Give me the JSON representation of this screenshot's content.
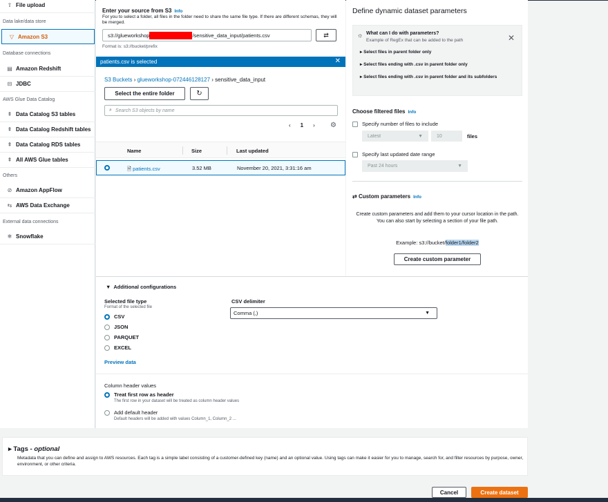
{
  "sidebar": {
    "items": [
      {
        "label": "File upload",
        "icon": "upload-icon",
        "glyph": "⇧"
      },
      {
        "label": "Amazon S3",
        "icon": "bucket-icon",
        "glyph": "▽"
      },
      {
        "label": "Amazon Redshift",
        "icon": "database-icon",
        "glyph": "▤"
      },
      {
        "label": "JDBC",
        "icon": "jdbc-icon",
        "glyph": "⊟"
      },
      {
        "label": "Data Catalog S3 tables",
        "icon": "catalog-icon",
        "glyph": "⇞"
      },
      {
        "label": "Data Catalog Redshift tables",
        "icon": "catalog-icon",
        "glyph": "⇞"
      },
      {
        "label": "Data Catalog RDS tables",
        "icon": "catalog-icon",
        "glyph": "⇞"
      },
      {
        "label": "All AWS Glue tables",
        "icon": "catalog-icon",
        "glyph": "⇞"
      },
      {
        "label": "Amazon AppFlow",
        "icon": "appflow-icon",
        "glyph": "⊘"
      },
      {
        "label": "AWS Data Exchange",
        "icon": "exchange-icon",
        "glyph": "⇆"
      },
      {
        "label": "Snowflake",
        "icon": "snowflake-icon",
        "glyph": "❄"
      }
    ],
    "sections": [
      "Data lake/data store",
      "Database connections",
      "AWS Glue Data Catalog",
      "Others",
      "External data connections"
    ]
  },
  "source": {
    "title": "Enter your source from S3",
    "info": "Info",
    "description": "For you to select a folder, all files in the folder need to share the same file type. If there are different schemas, they will be merged.",
    "path_prefix": "s3://glueworkshop",
    "path_suffix": "/sensitive_data_input/patients.csv",
    "format_hint": "Format is: s3://bucket/prefix"
  },
  "browser": {
    "banner": "patients.csv is selected",
    "crumb_root": "S3 Buckets",
    "crumb_bucket": "glueworkshop-072446128127",
    "crumb_folder": "sensitive_data_input",
    "select_folder": "Select the entire folder",
    "search_placeholder": "Search S3 objects by name",
    "page": "1",
    "columns": [
      "Name",
      "Size",
      "Last updated"
    ],
    "rows": [
      {
        "name": "patients.csv",
        "size": "3.52 MB",
        "updated": "November 20, 2021, 3:31:16 am"
      }
    ]
  },
  "params": {
    "title": "Define dynamic dataset parameters",
    "help_title": "What can I do with parameters?",
    "help_sub": "Example of RegEx that can be added to the path",
    "help_items": [
      "Select files in parent folder only",
      "Select files ending with .csv in parent folder only",
      "Select files ending with .csv in parent folder and its subfolders"
    ],
    "filtered_title": "Choose filtered files",
    "info": "Info",
    "num_files_label": "Specify number of files to include",
    "num_files_mode": "Latest",
    "num_files_value": "10",
    "files_word": "files",
    "date_label": "Specify last updated date range",
    "date_value": "Past 24 hours",
    "custom_title": "Custom parameters",
    "custom_desc": "Create custom parameters and add them to your cursor location in the path. You can also start by selecting a section of your file path.",
    "example_prefix": "Example: s3://bucket/",
    "example_highlight": "folder1/folder2",
    "custom_button": "Create custom parameter"
  },
  "additional": {
    "title": "Additional configurations",
    "file_type_label": "Selected file type",
    "file_type_sub": "Format of the selected file",
    "file_types": [
      "CSV",
      "JSON",
      "PARQUET",
      "EXCEL"
    ],
    "selected_type": "CSV",
    "delimiter_label": "CSV delimiter",
    "delimiter_value": "Comma (,)",
    "preview": "Preview data",
    "header_label": "Column header values",
    "header_opt1": "Treat first row as header",
    "header_opt1_sub": "The first row in your dataset will be treated as column header values",
    "header_opt2": "Add default header",
    "header_opt2_sub": "Default headers will be added with values Column_1, Column_2 ..."
  },
  "tags": {
    "title": "Tags",
    "optional": "optional",
    "description": "Metadata that you can define and assign to AWS resources. Each tag is a simple label consisting of a customer-defined key (name) and an optional value. Using tags can make it easier for you to manage, search for, and filter resources by purpose, owner, environment, or other criteria."
  },
  "footer": {
    "cancel": "Cancel",
    "create": "Create dataset"
  },
  "colors": {
    "accent": "#0073bb",
    "primary": "#ec7211",
    "redaction": "#ff0000"
  }
}
